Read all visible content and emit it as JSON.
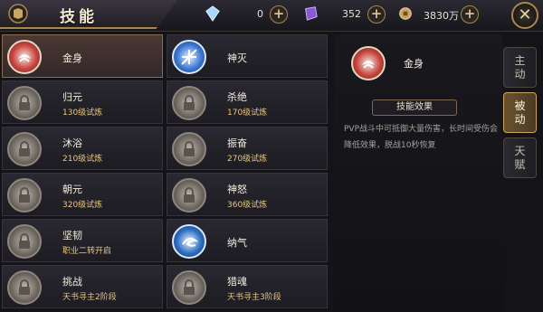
{
  "header": {
    "title": "技能",
    "resources": [
      {
        "icon": "diamond-icon",
        "amount": "0"
      },
      {
        "icon": "crystal-icon",
        "amount": "352"
      },
      {
        "icon": "coin-icon",
        "amount": "3830万"
      }
    ],
    "close_label": "✕"
  },
  "skills": [
    {
      "name": "金身",
      "requirement": "",
      "icon": "golden-body-icon",
      "selected": true
    },
    {
      "name": "神灭",
      "requirement": "",
      "icon": "divine-destruction-icon"
    },
    {
      "name": "归元",
      "requirement": "130级试炼",
      "icon": "locked-skill-icon"
    },
    {
      "name": "杀绝",
      "requirement": "170级试炼",
      "icon": "locked-skill-icon"
    },
    {
      "name": "沐浴",
      "requirement": "210级试炼",
      "icon": "locked-skill-icon"
    },
    {
      "name": "振奋",
      "requirement": "270级试炼",
      "icon": "locked-skill-icon"
    },
    {
      "name": "朝元",
      "requirement": "320级试炼",
      "icon": "locked-skill-icon"
    },
    {
      "name": "神怒",
      "requirement": "360级试炼",
      "icon": "locked-skill-icon"
    },
    {
      "name": "坚韧",
      "requirement": "职业二转开启",
      "icon": "locked-skill-icon"
    },
    {
      "name": "纳气",
      "requirement": "",
      "icon": "qi-gathering-icon"
    },
    {
      "name": "挑战",
      "requirement": "天书寻主2阶段",
      "icon": "locked-skill-icon"
    },
    {
      "name": "猎魂",
      "requirement": "天书寻主3阶段",
      "icon": "locked-skill-icon"
    }
  ],
  "detail": {
    "name": "金身",
    "effect_label": "技能效果",
    "description_line1": "PVP战斗中可抵御大量伤害，长时间受伤会",
    "description_line2": "降低效果，脱战10秒恢复"
  },
  "tabs": [
    {
      "label_line1": "主",
      "label_line2": "动",
      "active": false
    },
    {
      "label_line1": "被",
      "label_line2": "动",
      "active": true
    },
    {
      "label_line1": "天",
      "label_line2": "赋",
      "active": false
    }
  ]
}
